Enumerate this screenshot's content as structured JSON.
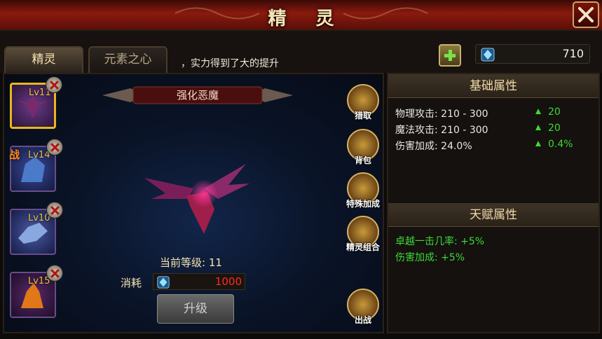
{
  "window": {
    "title": "精灵"
  },
  "tabs": [
    {
      "label": "精灵",
      "active": true
    },
    {
      "label": "元素之心",
      "active": false
    }
  ],
  "notice": "，实力得到了大的提升",
  "currency": {
    "icon": "gem-icon",
    "value": "710"
  },
  "pets": [
    {
      "level": "Lv11",
      "selected": true,
      "tag": ""
    },
    {
      "level": "Lv14",
      "selected": false,
      "tag": "战"
    },
    {
      "level": "Lv10",
      "selected": false,
      "tag": ""
    },
    {
      "level": "Lv15",
      "selected": false,
      "tag": ""
    }
  ],
  "current_pet": {
    "name": "强化恶魔",
    "level_label": "当前等级:",
    "level": "11",
    "cost_label": "消耗",
    "cost_value": "1000",
    "upgrade_label": "升级"
  },
  "side_buttons": [
    {
      "label": "猎取",
      "icon": "net-icon"
    },
    {
      "label": "背包",
      "icon": "bag-icon"
    },
    {
      "label": "特殊加成",
      "icon": "arrow-icon"
    },
    {
      "label": "精灵组合",
      "icon": "helmet-icon"
    },
    {
      "label": "出战",
      "icon": "swords-icon"
    }
  ],
  "base_attributes": {
    "heading": "基础属性",
    "rows": [
      {
        "label": "物理攻击: 210 - 300",
        "increase": "20"
      },
      {
        "label": "魔法攻击: 210 - 300",
        "increase": "20"
      },
      {
        "label": "伤害加成: 24.0%",
        "increase": "0.4%"
      }
    ]
  },
  "talent_attributes": {
    "heading": "天赋属性",
    "rows": [
      "卓越一击几率: +5%",
      "伤害加成: +5%"
    ]
  },
  "colors": {
    "accent": "#e6b81c",
    "increase": "#3ed83a",
    "cost": "#ff2a22",
    "title_bar": "#8a1a0e"
  }
}
